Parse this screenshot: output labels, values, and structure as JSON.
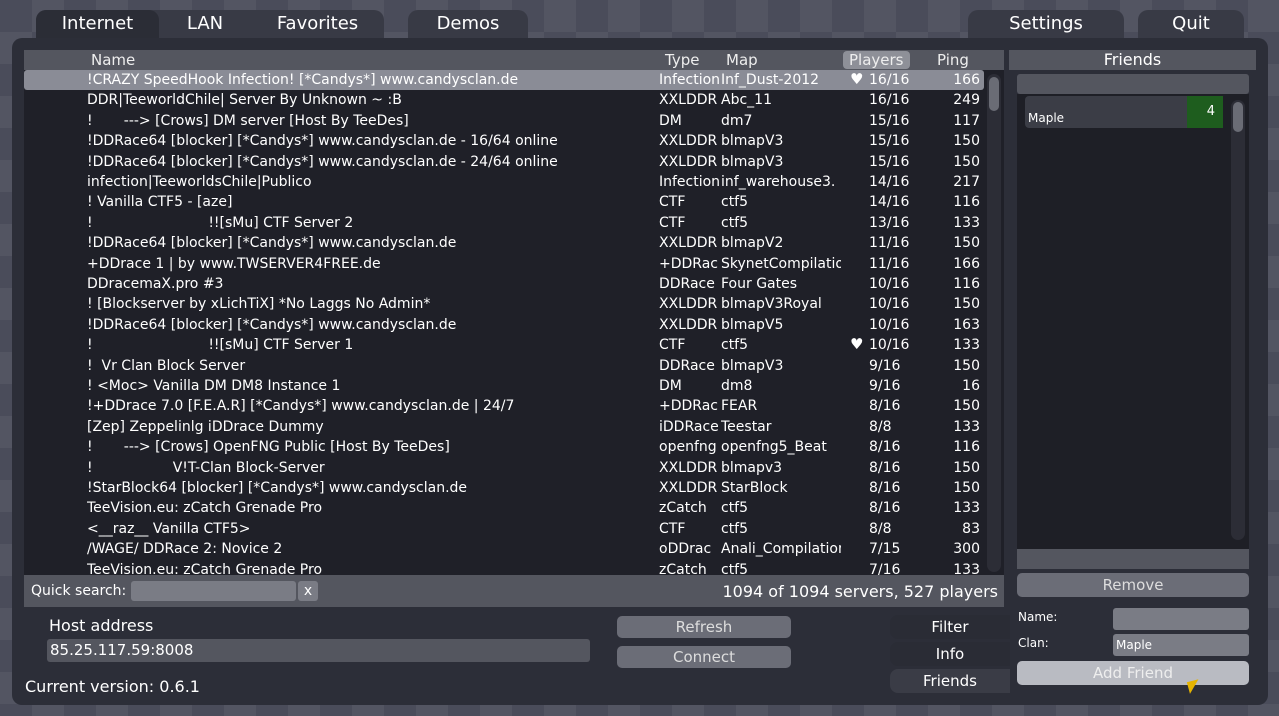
{
  "tabs": {
    "internet": "Internet",
    "lan": "LAN",
    "favorites": "Favorites",
    "demos": "Demos",
    "settings": "Settings",
    "quit": "Quit"
  },
  "columns": {
    "name": "Name",
    "type": "Type",
    "map": "Map",
    "players": "Players",
    "ping": "Ping"
  },
  "servers": [
    {
      "icon": "warning",
      "name": "!CRAZY SpeedHook Infection! [*Candys*] www.candysclan.de",
      "type": "Infection",
      "map": "Inf_Dust-2012",
      "fav": true,
      "players": "16/16",
      "ping": "166",
      "selected": true
    },
    {
      "icon": "warning",
      "name": "DDR|TeeworldChile| Server By Unknown ~ :B",
      "type": "XXLDDR",
      "map": "Abc_11",
      "fav": false,
      "players": "16/16",
      "ping": "249"
    },
    {
      "icon": "",
      "name": "!       ---> [Crows] DM server [Host By TeeDes]",
      "type": "DM",
      "map": "dm7",
      "fav": false,
      "players": "15/16",
      "ping": "117"
    },
    {
      "icon": "warning",
      "name": "!DDRace64 [blocker] [*Candys*] www.candysclan.de - 16/64 online",
      "type": "XXLDDR",
      "map": "blmapV3",
      "fav": false,
      "players": "15/16",
      "ping": "150"
    },
    {
      "icon": "warning",
      "name": "!DDRace64 [blocker] [*Candys*] www.candysclan.de - 24/64 online",
      "type": "XXLDDR",
      "map": "blmapV3",
      "fav": false,
      "players": "15/16",
      "ping": "150"
    },
    {
      "icon": "warning",
      "name": "infection|TeeworldsChile|Publico",
      "type": "Infection",
      "map": "inf_warehouse3.",
      "fav": false,
      "players": "14/16",
      "ping": "217"
    },
    {
      "icon": "",
      "name": "! Vanilla CTF5 - [aze]",
      "type": "CTF",
      "map": "ctf5",
      "fav": false,
      "players": "14/16",
      "ping": "116"
    },
    {
      "icon": "",
      "name": "!                          !![sMu] CTF Server 2",
      "type": "CTF",
      "map": "ctf5",
      "fav": false,
      "players": "13/16",
      "ping": "133"
    },
    {
      "icon": "warning",
      "name": "!DDRace64 [blocker] [*Candys*] www.candysclan.de",
      "type": "XXLDDR",
      "map": "blmapV2",
      "fav": false,
      "players": "11/16",
      "ping": "150"
    },
    {
      "icon": "warning",
      "name": "+DDrace 1 | by www.TWSERVER4FREE.de",
      "type": "+DDRac",
      "map": "SkynetCompilatio",
      "fav": false,
      "players": "11/16",
      "ping": "166"
    },
    {
      "icon": "warning",
      "name": "DDracemaX.pro #3",
      "type": "DDRace",
      "map": "Four Gates",
      "fav": false,
      "players": "10/16",
      "ping": "116"
    },
    {
      "icon": "warning",
      "name": "! [Blockserver by xLichTiX] *No Laggs No Admin*",
      "type": "XXLDDR",
      "map": "blmapV3Royal",
      "fav": false,
      "players": "10/16",
      "ping": "150"
    },
    {
      "icon": "warning",
      "name": "!DDRace64 [blocker] [*Candys*] www.candysclan.de",
      "type": "XXLDDR",
      "map": "blmapV5",
      "fav": false,
      "players": "10/16",
      "ping": "163"
    },
    {
      "icon": "",
      "name": "!                          !![sMu] CTF Server 1",
      "type": "CTF",
      "map": "ctf5",
      "fav": true,
      "players": "10/16",
      "ping": "133"
    },
    {
      "icon": "warning",
      "name": "!  Vr Clan Block Server",
      "type": "DDRace",
      "map": "blmapV3",
      "fav": false,
      "players": "9/16",
      "ping": "150"
    },
    {
      "icon": "",
      "name": "! <Moc> Vanilla DM DM8 Instance 1",
      "type": "DM",
      "map": "dm8",
      "fav": false,
      "players": "9/16",
      "ping": "16"
    },
    {
      "icon": "warning",
      "name": "!+DDrace 7.0 [F.E.A.R] [*Candys*] www.candysclan.de | 24/7",
      "type": "+DDRac",
      "map": "FEAR",
      "fav": false,
      "players": "8/16",
      "ping": "150"
    },
    {
      "icon": "warning",
      "name": "[Zep] Zeppelinlg iDDrace Dummy",
      "type": "iDDRace",
      "map": "Teestar",
      "fav": false,
      "players": "8/8",
      "ping": "133"
    },
    {
      "icon": "warning",
      "name": "!       ---> [Crows] OpenFNG Public [Host By TeeDes]",
      "type": "openfng",
      "map": "openfng5_Beat",
      "fav": false,
      "players": "8/16",
      "ping": "116"
    },
    {
      "icon": "warning",
      "name": "!                  V!T-Clan Block-Server",
      "type": "XXLDDR",
      "map": "blmapv3",
      "fav": false,
      "players": "8/16",
      "ping": "150"
    },
    {
      "icon": "warning",
      "name": "!StarBlock64 [blocker] [*Candys*] www.candysclan.de",
      "type": "XXLDDR",
      "map": "StarBlock",
      "fav": false,
      "players": "8/16",
      "ping": "150"
    },
    {
      "icon": "warning",
      "name": "TeeVision.eu: zCatch Grenade Pro",
      "type": "zCatch",
      "map": "ctf5",
      "fav": false,
      "players": "8/16",
      "ping": "133"
    },
    {
      "icon": "",
      "name": "<__raz__ Vanilla CTF5>",
      "type": "CTF",
      "map": "ctf5",
      "fav": false,
      "players": "8/8",
      "ping": "83"
    },
    {
      "icon": "warning",
      "name": "/WAGE/ DDRace 2: Novice 2",
      "type": "oDDrac",
      "map": "Anali_Compilation",
      "fav": false,
      "players": "7/15",
      "ping": "300"
    },
    {
      "icon": "warning",
      "name": "TeeVision.eu: zCatch Grenade Pro",
      "type": "zCatch",
      "map": "ctf5",
      "fav": false,
      "players": "7/16",
      "ping": "133"
    }
  ],
  "search": {
    "label": "Quick search:",
    "value": "",
    "clear": "x"
  },
  "status": {
    "count_text": "1094 of 1094 servers, 527 players"
  },
  "host": {
    "label": "Host address",
    "value": "85.25.117.59:8008"
  },
  "buttons": {
    "refresh": "Refresh",
    "connect": "Connect",
    "remove": "Remove",
    "add_friend": "Add Friend"
  },
  "sidetabs": {
    "filter": "Filter",
    "info": "Info",
    "friends": "Friends"
  },
  "version": "Current version: 0.6.1",
  "friends": {
    "title": "Friends",
    "items": [
      {
        "name": "Maple",
        "count": "4"
      }
    ],
    "name_label": "Name:",
    "name_value": "",
    "clan_label": "Clan:",
    "clan_value": "Maple"
  }
}
